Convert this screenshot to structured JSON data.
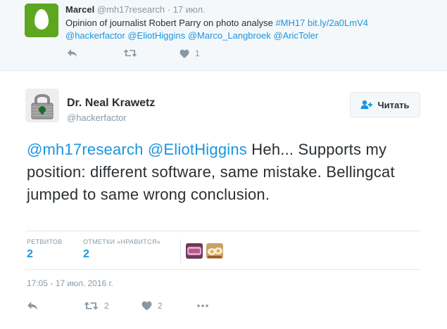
{
  "parent_tweet": {
    "author_name": "Marcel",
    "author_handle": "@mh17research",
    "date": "17 июл.",
    "text_plain": "Opinion of journalist Robert Parry on photo analyse ",
    "hashtag": "#MH17",
    "link": "bit.ly/2a0LmV4",
    "mentions": [
      "@hackerfactor",
      "@EliotHiggins",
      "@Marco_Langbroek",
      "@AricToler"
    ],
    "actions": {
      "reply_icon": "reply-icon",
      "retweet_icon": "retweet-icon",
      "like_icon": "heart-icon",
      "like_count": "1",
      "more_icon": "more-icon"
    }
  },
  "main_tweet": {
    "author_name": "Dr. Neal Krawetz",
    "author_handle": "@hackerfactor",
    "follow_label": "Читать",
    "mention_1": "@mh17research",
    "mention_2": "@EliotHiggins",
    "text_rest": " Heh... Supports my position: different software, same mistake. Bellingcat jumped to same wrong conclusion.",
    "stats": {
      "retweets_label": "РЕТВИТОВ",
      "retweets_value": "2",
      "likes_label": "ОТМЕТКИ «НРАВИТСЯ»",
      "likes_value": "2"
    },
    "timestamp": "17:05 - 17 июл. 2016 г.",
    "actions": {
      "reply_icon": "reply-icon",
      "retweet_icon": "retweet-icon",
      "retweet_count": "2",
      "like_icon": "heart-icon",
      "like_count": "2",
      "more_icon": "more-icon"
    }
  },
  "colors": {
    "link": "#1b95e0",
    "muted": "#8899a6",
    "text": "#292f33",
    "parent_bg": "#f5f8fa",
    "avatar_green": "#5ca71f"
  }
}
